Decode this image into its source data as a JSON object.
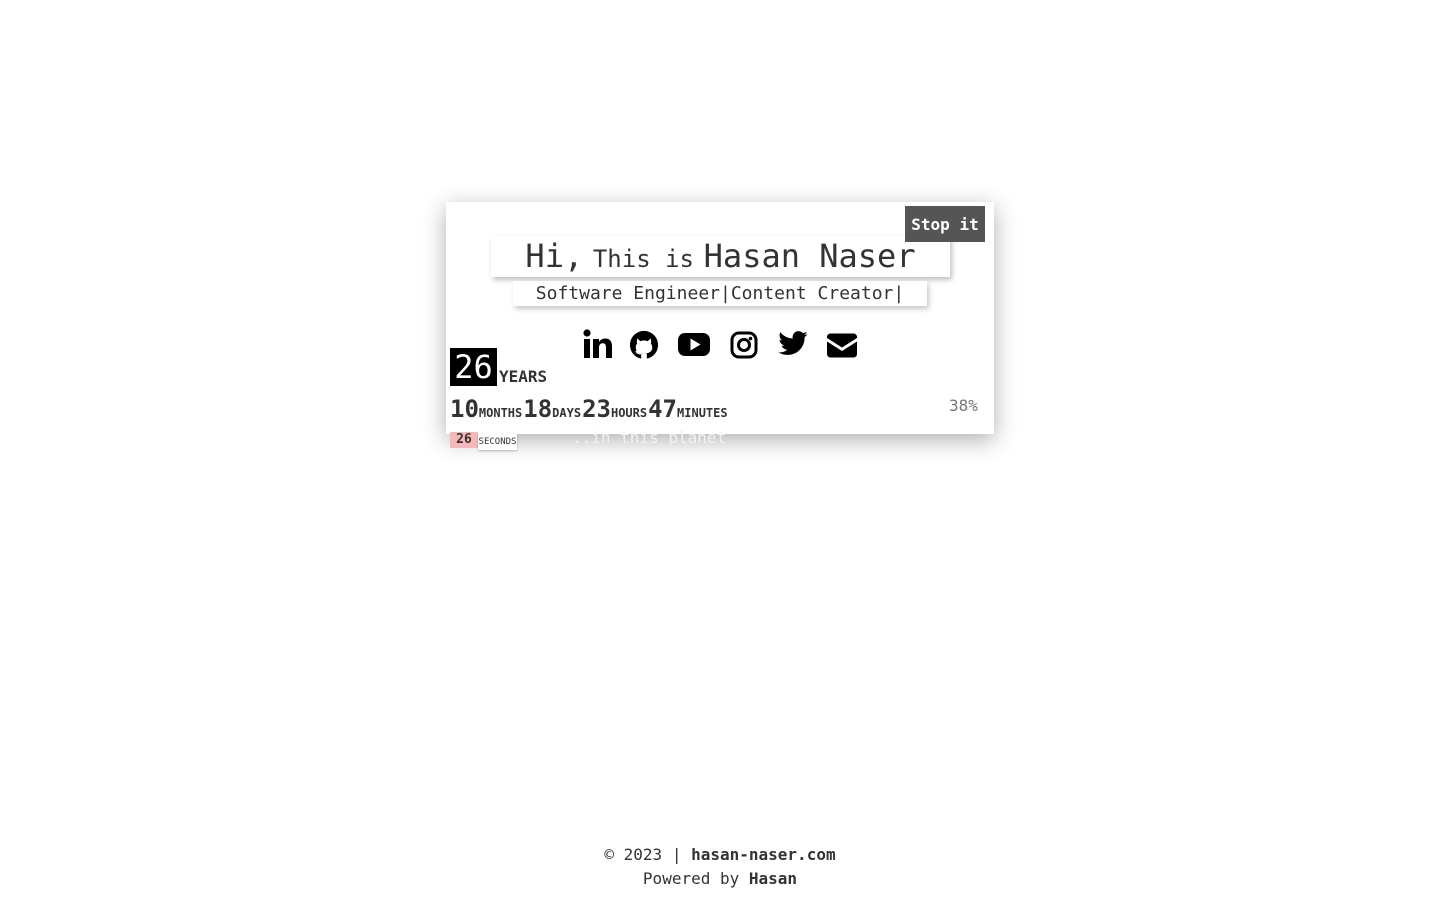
{
  "stop_button": {
    "label": "Stop it"
  },
  "header": {
    "greeting": "Hi,",
    "this_is": "This is",
    "name": "Hasan Naser",
    "subtitle": "Software Engineer|Content Creator|"
  },
  "social": [
    {
      "icon": "linkedin-icon"
    },
    {
      "icon": "github-icon"
    },
    {
      "icon": "youtube-icon"
    },
    {
      "icon": "instagram-icon"
    },
    {
      "icon": "twitter-icon"
    },
    {
      "icon": "envelope-icon"
    }
  ],
  "age": {
    "years": "26",
    "years_label": "YEARS",
    "months": "10",
    "months_label": "MONTHS",
    "days": "18",
    "days_label": "DAYS",
    "hours": "23",
    "hours_label": "HOURS",
    "minutes": "47",
    "minutes_label": "MINUTES",
    "seconds": "26",
    "seconds_label": "SECONDS",
    "progress": "38%",
    "planet_text": "..in this planet"
  },
  "footer": {
    "copyright": "© 2023 | ",
    "site": "hasan-naser.com",
    "powered": "Powered by ",
    "author": "Hasan"
  },
  "colors": {
    "accent_dark": "#555555",
    "seconds_bg": "#f5b8b8",
    "text": "#333333"
  }
}
